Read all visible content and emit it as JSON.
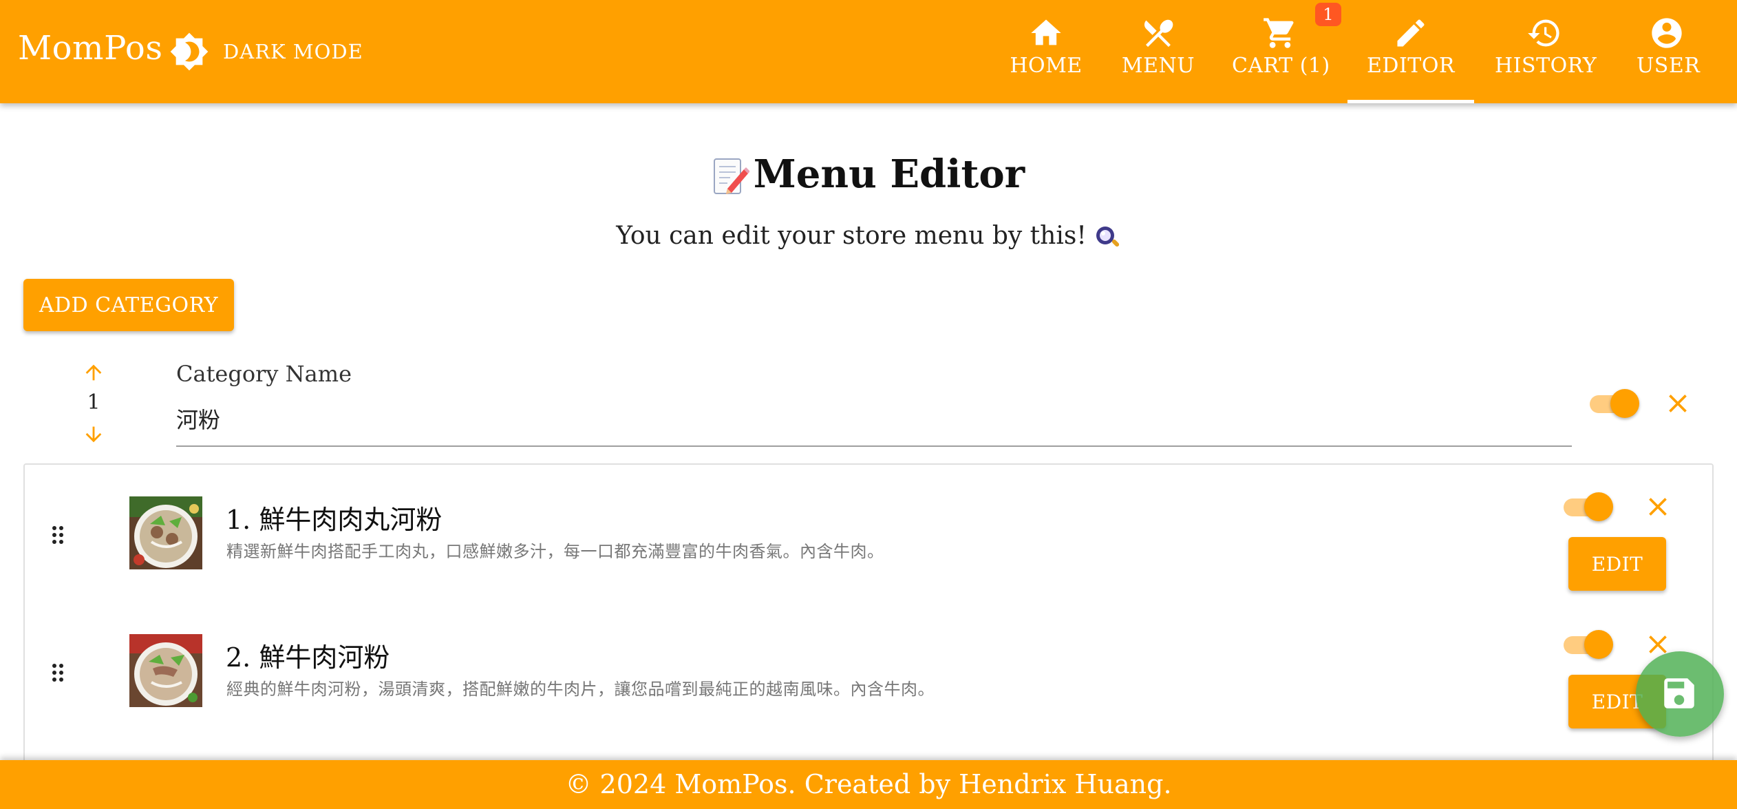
{
  "app": {
    "brand": "MomPos"
  },
  "header": {
    "theme_toggle_label": "DARK MODE",
    "nav": [
      {
        "id": "home",
        "label": "HOME",
        "icon": "home-icon"
      },
      {
        "id": "menu",
        "label": "MENU",
        "icon": "utensils-icon"
      },
      {
        "id": "cart",
        "label": "CART (1)",
        "icon": "cart-icon",
        "badge": "1"
      },
      {
        "id": "editor",
        "label": "EDITOR",
        "icon": "pencil-icon",
        "active": true
      },
      {
        "id": "history",
        "label": "HISTORY",
        "icon": "history-icon"
      },
      {
        "id": "user",
        "label": "USER",
        "icon": "account-icon"
      }
    ]
  },
  "main": {
    "title": "Menu Editor",
    "subtitle": "You can edit your store menu by this!",
    "add_category_label": "ADD CATEGORY",
    "category": {
      "index": "1",
      "name_label": "Category Name",
      "name_value": "河粉",
      "enabled": true
    },
    "items": [
      {
        "name": "1. 鮮牛肉肉丸河粉",
        "description": "精選新鮮牛肉搭配手工肉丸，口感鮮嫩多汁，每一口都充滿豐富的牛肉香氣。內含牛肉。",
        "enabled": true,
        "edit_label": "EDIT"
      },
      {
        "name": "2. 鮮牛肉河粉",
        "description": "經典的鮮牛肉河粉，湯頭清爽，搭配鮮嫩的牛肉片，讓您品嚐到最純正的越南風味。內含牛肉。",
        "enabled": true,
        "edit_label": "EDIT"
      }
    ]
  },
  "footer": {
    "text": "© 2024 MomPos. Created by Hendrix Huang."
  },
  "colors": {
    "primary": "#FFA000",
    "badge": "#FF5722",
    "save_fab": "#4CAF50",
    "toggle_track": "#FFCC80"
  }
}
